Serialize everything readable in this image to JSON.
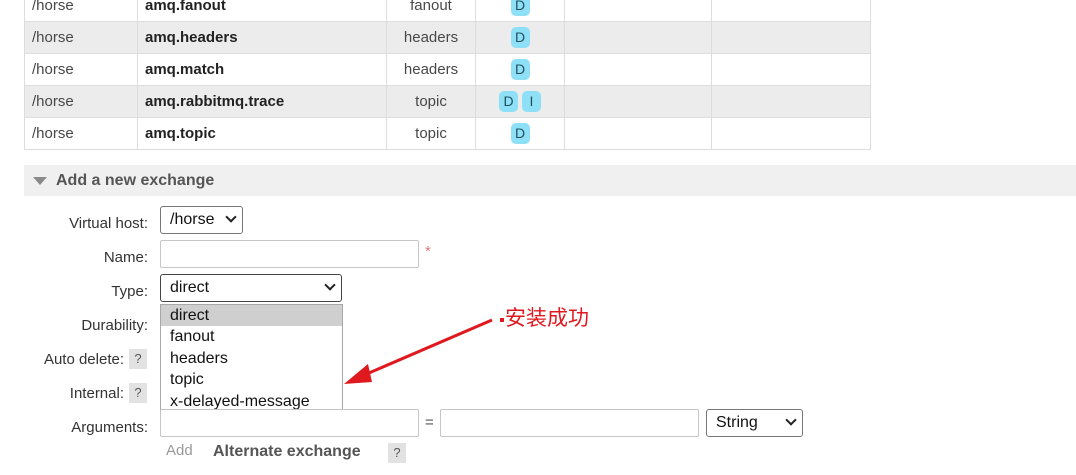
{
  "exchanges": [
    {
      "vhost": "/horse",
      "name": "amq.fanout",
      "type": "fanout",
      "features": [
        "D"
      ]
    },
    {
      "vhost": "/horse",
      "name": "amq.headers",
      "type": "headers",
      "features": [
        "D"
      ]
    },
    {
      "vhost": "/horse",
      "name": "amq.match",
      "type": "headers",
      "features": [
        "D"
      ]
    },
    {
      "vhost": "/horse",
      "name": "amq.rabbitmq.trace",
      "type": "topic",
      "features": [
        "D",
        "I"
      ]
    },
    {
      "vhost": "/horse",
      "name": "amq.topic",
      "type": "topic",
      "features": [
        "D"
      ]
    }
  ],
  "section": {
    "title": "Add a new exchange"
  },
  "form": {
    "virtual_host_label": "Virtual host:",
    "virtual_host_value": "/horse",
    "name_label": "Name:",
    "name_value": "",
    "required_mark": "*",
    "type_label": "Type:",
    "type_value": "direct",
    "type_options": [
      "direct",
      "fanout",
      "headers",
      "topic",
      "x-delayed-message"
    ],
    "durability_label": "Durability:",
    "auto_delete_label": "Auto delete:",
    "internal_label": "Internal:",
    "arguments_label": "Arguments:",
    "help_mark": "?",
    "equals": "=",
    "arg_type_value": "String",
    "add_link": "Add",
    "alternate_exchange": "Alternate exchange"
  },
  "annotation": {
    "text": "安装成功",
    "color": "#e0191f"
  },
  "colors": {
    "badge": "#8ee0f6",
    "row_alt": "#ececec",
    "section_bg": "#f0f0f0"
  }
}
